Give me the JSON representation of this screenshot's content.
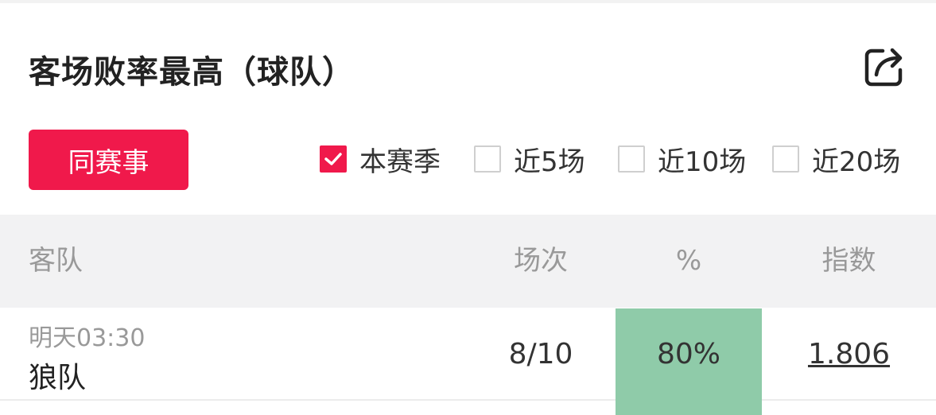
{
  "panel": {
    "title": "客场败率最高（球队）",
    "share_icon": "share-export-icon"
  },
  "same_event_button": "同赛事",
  "filters": [
    {
      "label": "本赛季",
      "checked": true
    },
    {
      "label": "近5场",
      "checked": false
    },
    {
      "label": "近10场",
      "checked": false
    },
    {
      "label": "近20场",
      "checked": false
    }
  ],
  "table": {
    "headers": {
      "team": "客队",
      "games": "场次",
      "percent": "%",
      "index": "指数"
    },
    "rows": [
      {
        "time": "明天03:30",
        "team": "狼队",
        "games": "8/10",
        "percent": "80%",
        "index": "1.806"
      }
    ]
  },
  "colors": {
    "accent": "#f0194b",
    "highlight": "#8fcba9",
    "header_bg": "#f2f2f3"
  }
}
